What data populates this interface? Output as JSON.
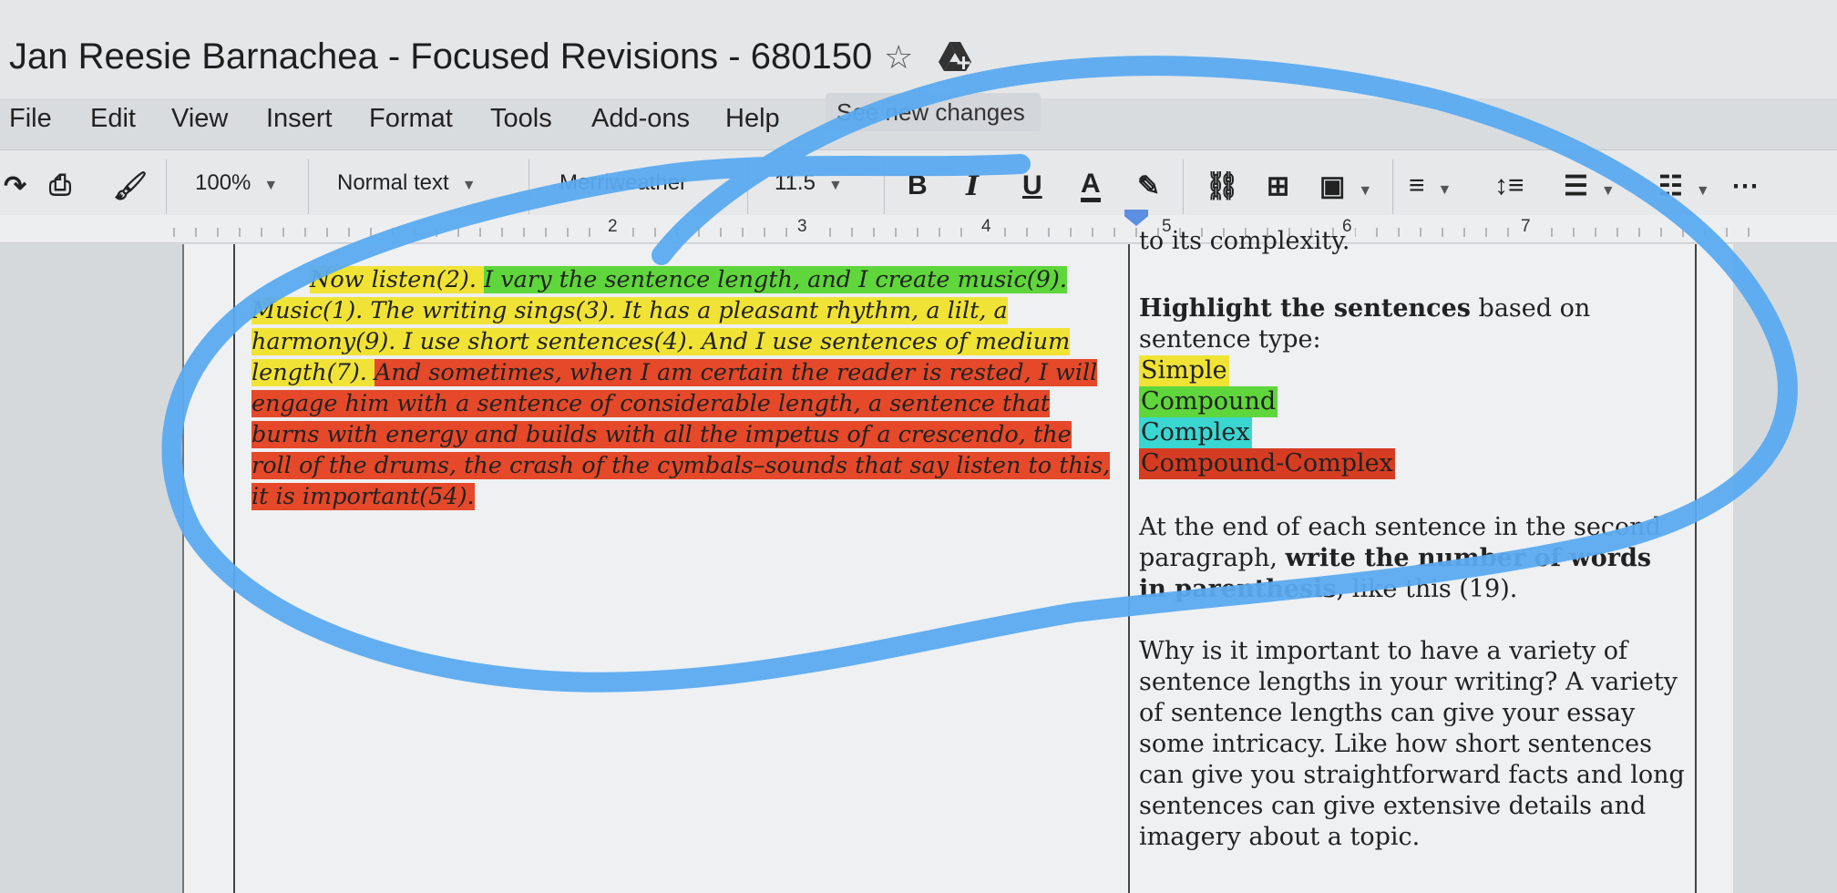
{
  "window": {
    "doc_title": "Jan Reesie Barnachea - Focused Revisions - 680150"
  },
  "menu": {
    "items": [
      "File",
      "Edit",
      "View",
      "Insert",
      "Format",
      "Tools",
      "Add-ons",
      "Help"
    ],
    "see_changes": "See new changes"
  },
  "toolbar": {
    "zoom": "100%",
    "style": "Normal text",
    "font": "Merriweather",
    "font_size": "11.5"
  },
  "ruler": {
    "marks": [
      "2",
      "3",
      "4",
      "5",
      "6",
      "7"
    ]
  },
  "passage": {
    "s1": "Now listen(2). ",
    "s2": "I vary the sentence length, and I create music(9).",
    "s3": " Music(1). The writing sings(3). It has a pleasant rhythm, a lilt, a harmony(9). I use short sentences(4). And I use sentences of medium length(7). ",
    "s4": "And sometimes, when I am certain the reader is rested, I will engage him with a sentence of considerable length, a sentence that burns with energy and builds with all the impetus of a crescendo, the roll of the drums, the crash of the cymbals–sounds that say listen to this, it is important(54)."
  },
  "instructions": {
    "complexity_tail": "to its complexity.",
    "highlight_bold": "Highlight the sentences",
    "highlight_rest": " based on sentence type:",
    "legend": {
      "simple": "Simple",
      "compound": "Compound",
      "complex": "Complex",
      "compound_complex": "Compound-Complex"
    },
    "count_a": "At the end of each sentence in the second paragraph, ",
    "count_b": "write the number of words in parenthesis",
    "count_c": ", like this (19).",
    "question": "Why is it important to have a variety of sentence lengths in your writing? A variety of sentence lengths can give your essay some intricacy. Like how short sentences can give you straightforward facts and long sentences  can give extensive details and imagery about a topic."
  },
  "colors": {
    "simple": "#f1e335",
    "compound": "#5fd63b",
    "complex": "#3ad6d2",
    "compound_complex": "#d53c22",
    "annotation": "#5aaaf0"
  }
}
